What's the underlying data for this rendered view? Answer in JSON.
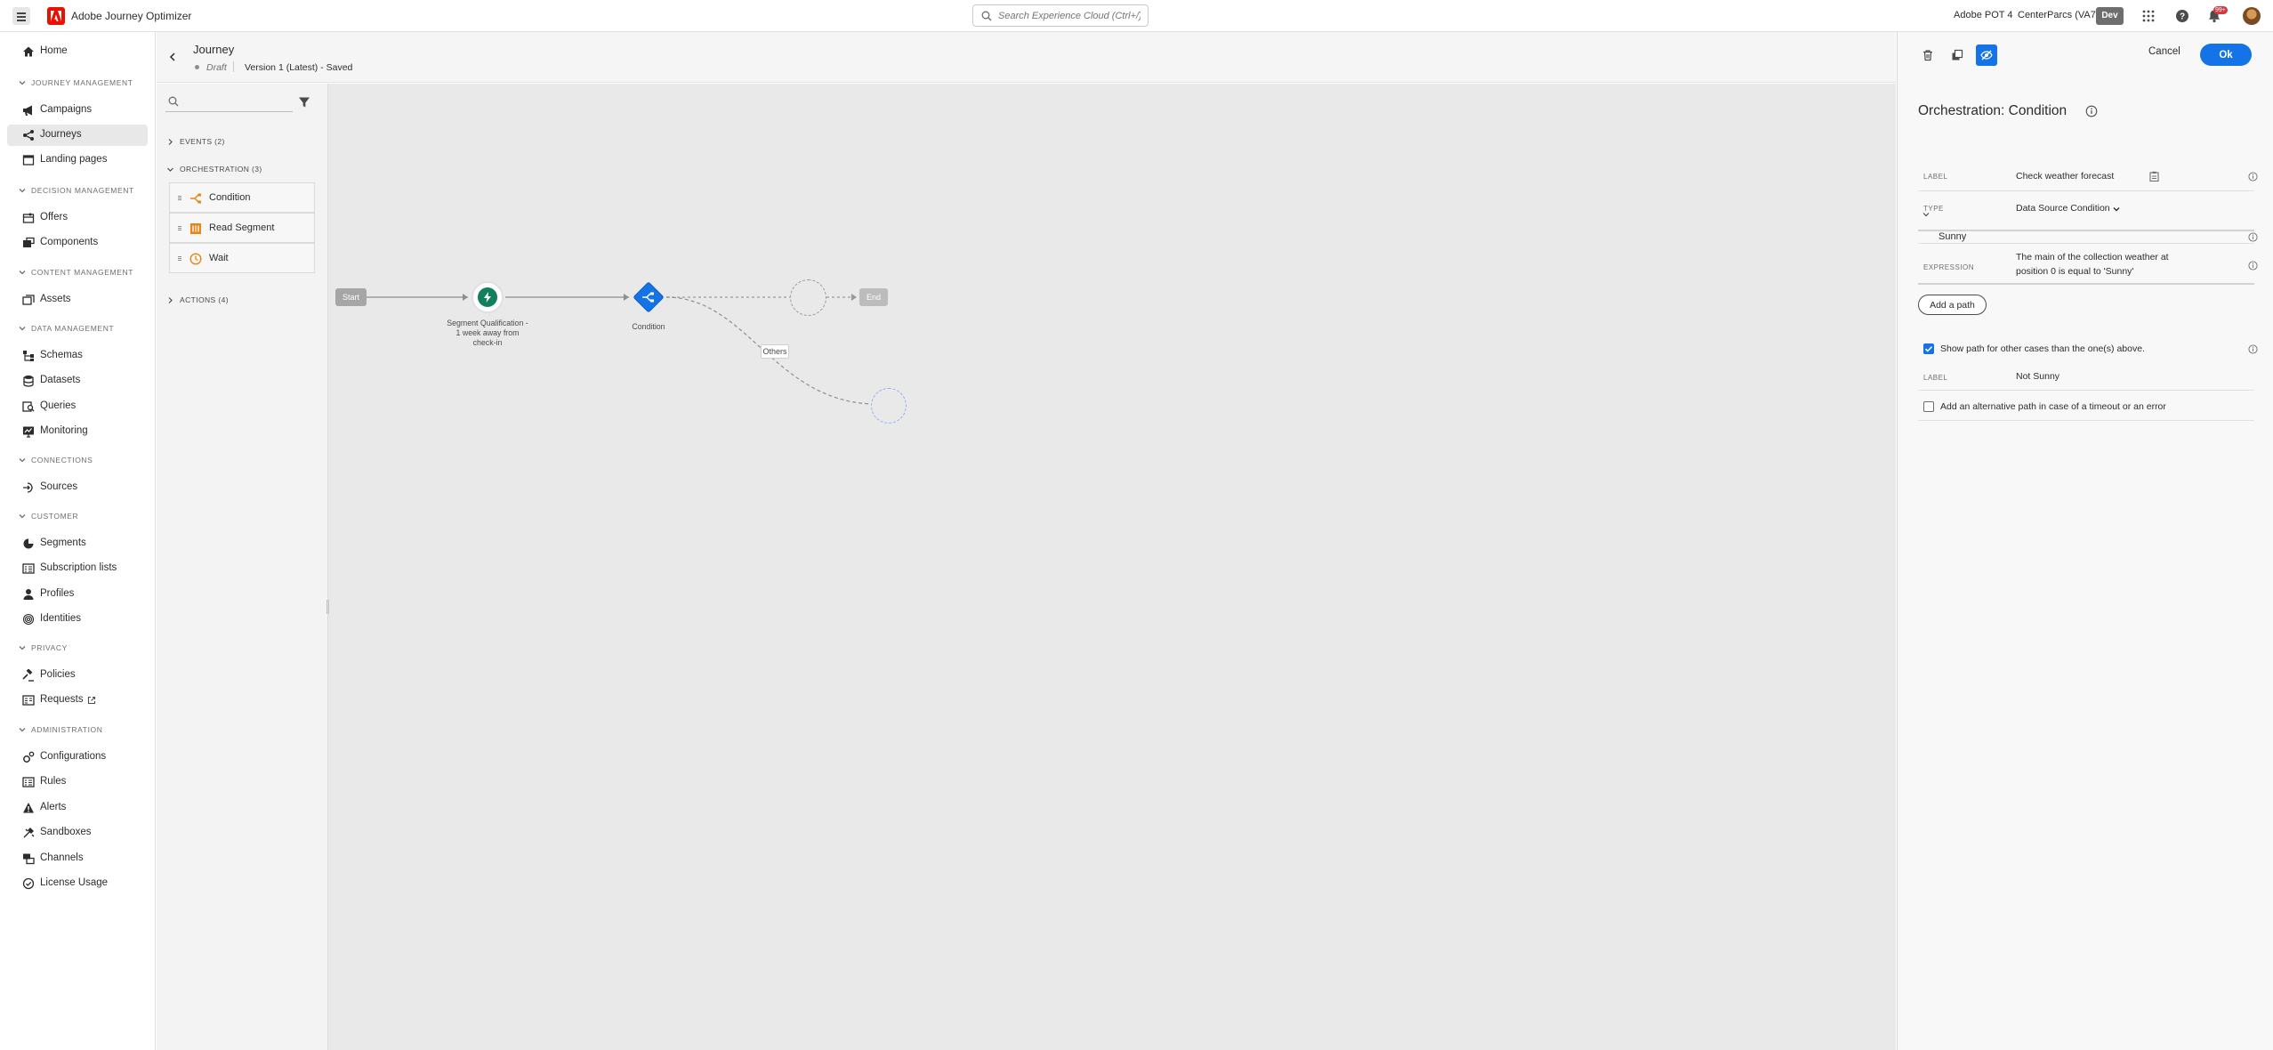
{
  "app": {
    "name": "Adobe Journey Optimizer"
  },
  "header": {
    "search_placeholder": "Search Experience Cloud (Ctrl+/)",
    "org_primary": "Adobe POT 4",
    "org_secondary": "CenterParcs (VA7)",
    "env_badge": "Dev",
    "notifications_count": "99+"
  },
  "nav": {
    "home": "Home",
    "sections": {
      "journey_management": "JOURNEY MANAGEMENT",
      "decision_management": "DECISION MANAGEMENT",
      "content_management": "CONTENT MANAGEMENT",
      "data_management": "DATA MANAGEMENT",
      "connections": "CONNECTIONS",
      "customer": "CUSTOMER",
      "privacy": "PRIVACY",
      "administration": "ADMINISTRATION"
    },
    "items": {
      "campaigns": "Campaigns",
      "journeys": "Journeys",
      "landing_pages": "Landing pages",
      "offers": "Offers",
      "components": "Components",
      "assets": "Assets",
      "schemas": "Schemas",
      "datasets": "Datasets",
      "queries": "Queries",
      "monitoring": "Monitoring",
      "sources": "Sources",
      "segments": "Segments",
      "subscription_lists": "Subscription lists",
      "profiles": "Profiles",
      "identities": "Identities",
      "policies": "Policies",
      "requests": "Requests",
      "configurations": "Configurations",
      "rules": "Rules",
      "alerts": "Alerts",
      "sandboxes": "Sandboxes",
      "channels": "Channels",
      "license_usage": "License Usage"
    },
    "active": "journeys"
  },
  "journey": {
    "title": "Journey",
    "status": "Draft",
    "version": "Version 1 (Latest) - Saved"
  },
  "palette": {
    "events_label": "EVENTS (2)",
    "orchestration_label": "ORCHESTRATION (3)",
    "actions_label": "ACTIONS (4)",
    "orchestration_items": [
      "Condition",
      "Read Segment",
      "Wait"
    ]
  },
  "canvas": {
    "start_label": "Start",
    "end_label": "End",
    "segment_node_label": "Segment Qualification - 1 week away from check-in",
    "condition_node_label": "Condition",
    "others_label": "Others"
  },
  "panel": {
    "cancel_label": "Cancel",
    "ok_label": "Ok",
    "title": "Orchestration: Condition",
    "label_key": "LABEL",
    "label_value": "Check weather forecast",
    "type_key": "TYPE",
    "type_value": "Data Source Condition",
    "path_name": "Sunny",
    "expression_key": "EXPRESSION",
    "expression_value": "The main of the collection weather at position 0 is equal to 'Sunny'",
    "add_path_label": "Add a path",
    "show_other_label": "Show path for other cases than the one(s) above.",
    "show_other_checked": true,
    "other_label_key": "LABEL",
    "other_label_value": "Not Sunny",
    "alt_path_label": "Add an alternative path in case of a timeout or an error",
    "alt_path_checked": false
  },
  "colors": {
    "accent": "#1473e6",
    "brand": "#eb1000",
    "segment_node": "#12805c",
    "condition_node": "#1473e6"
  }
}
